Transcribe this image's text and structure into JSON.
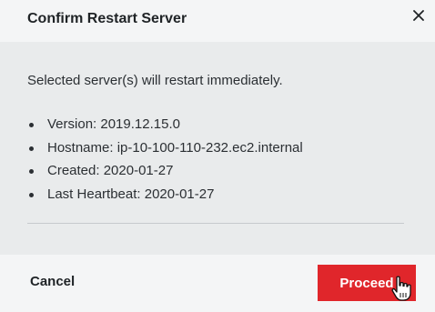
{
  "dialog": {
    "title": "Confirm Restart Server",
    "close_icon": "close-icon",
    "message": "Selected server(s) will restart immediately.",
    "details": [
      "Version: 2019.12.15.0",
      "Hostname: ip-10-100-110-232.ec2.internal",
      "Created: 2020-01-27",
      "Last Heartbeat: 2020-01-27"
    ],
    "cancel_label": "Cancel",
    "proceed_label": "Proceed",
    "colors": {
      "primary": "#e0262b",
      "header_bg": "#f4f5f6",
      "body_bg": "#e9ebec"
    }
  }
}
